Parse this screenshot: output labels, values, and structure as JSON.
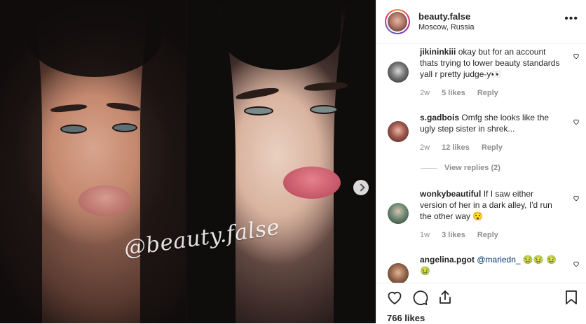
{
  "post": {
    "username": "beauty.false",
    "location": "Moscow, Russia",
    "watermark": "@beauty.false",
    "likes": "766 likes"
  },
  "comments": [
    {
      "user": "jikininkiii",
      "text": "okay but for an account thats trying to lower beauty standards yall r pretty judge-y👀",
      "time": "2w",
      "likes": "5 likes",
      "reply": "Reply"
    },
    {
      "user": "s.gadbois",
      "text": "Omfg she looks like the ugly step sister in shrek...",
      "time": "2w",
      "likes": "12 likes",
      "reply": "Reply",
      "view_replies": "View replies (2)"
    },
    {
      "user": "wonkybeautiful",
      "text": "If I saw either version of her in a dark alley, I'd run the other way 😯",
      "time": "1w",
      "likes": "3 likes",
      "reply": "Reply"
    },
    {
      "user": "angelina.pgot",
      "mention": "@mariedn_",
      "text": " 🤢🤢 🤢🤢"
    }
  ],
  "icons": {
    "more": "more-options-icon",
    "like": "heart-icon",
    "comment": "comment-icon",
    "share": "share-icon",
    "save": "bookmark-icon",
    "next": "chevron-right-icon"
  },
  "colors": {
    "text": "#262626",
    "muted": "#8e8e8e",
    "border": "#efefef",
    "mention": "#00376b"
  }
}
